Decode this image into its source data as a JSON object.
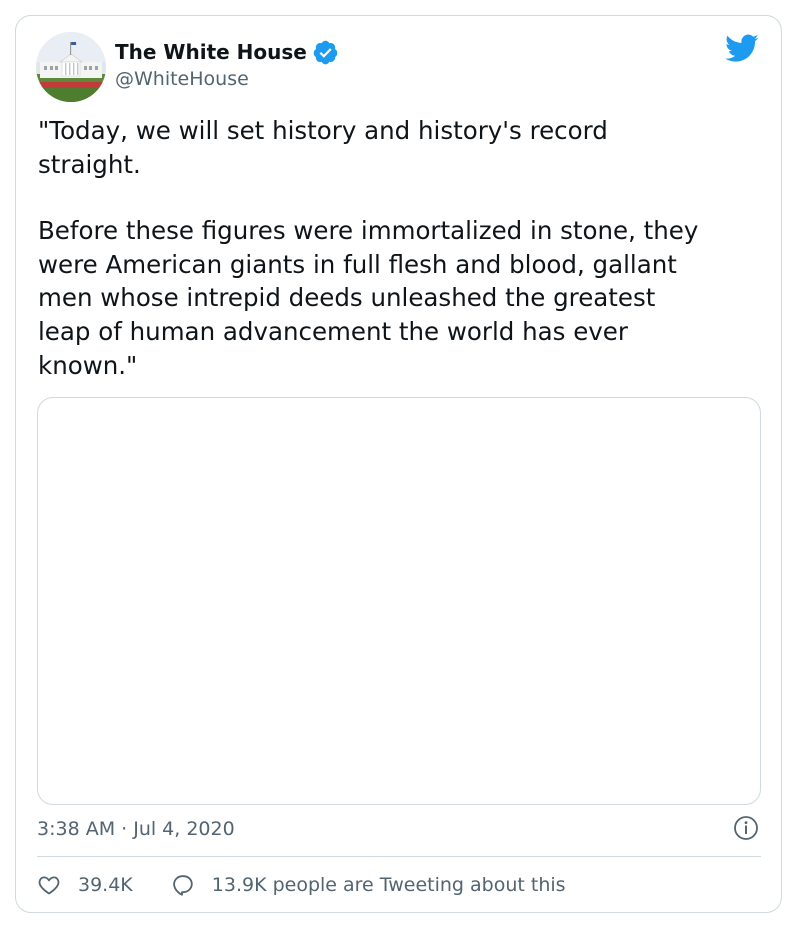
{
  "tweet": {
    "display_name": "The White House",
    "handle": "@WhiteHouse",
    "verified": true,
    "paragraph_1": "\"Today, we will set history and history's record\nstraight.",
    "paragraph_2": "Before these figures were immortalized in stone, they\nwere American giants in full flesh and blood, gallant\nmen whose intrepid deeds unleashed the greatest\nleap of human advancement the world has ever\nknown.\"",
    "timestamp": "3:38 AM · Jul 4, 2020"
  },
  "actions": {
    "likes": "39.4K",
    "tweeting": "13.9K people are Tweeting about this"
  },
  "colors": {
    "twitter_blue": "#1d9bf0",
    "text_primary": "#0f1419",
    "text_secondary": "#536471",
    "border": "#cfd9de"
  },
  "icons": {
    "avatar": "white-house-avatar",
    "verified": "verified-badge-icon",
    "brand": "twitter-bird-icon",
    "info": "info-icon",
    "like": "heart-icon",
    "reply": "speech-bubble-icon"
  }
}
